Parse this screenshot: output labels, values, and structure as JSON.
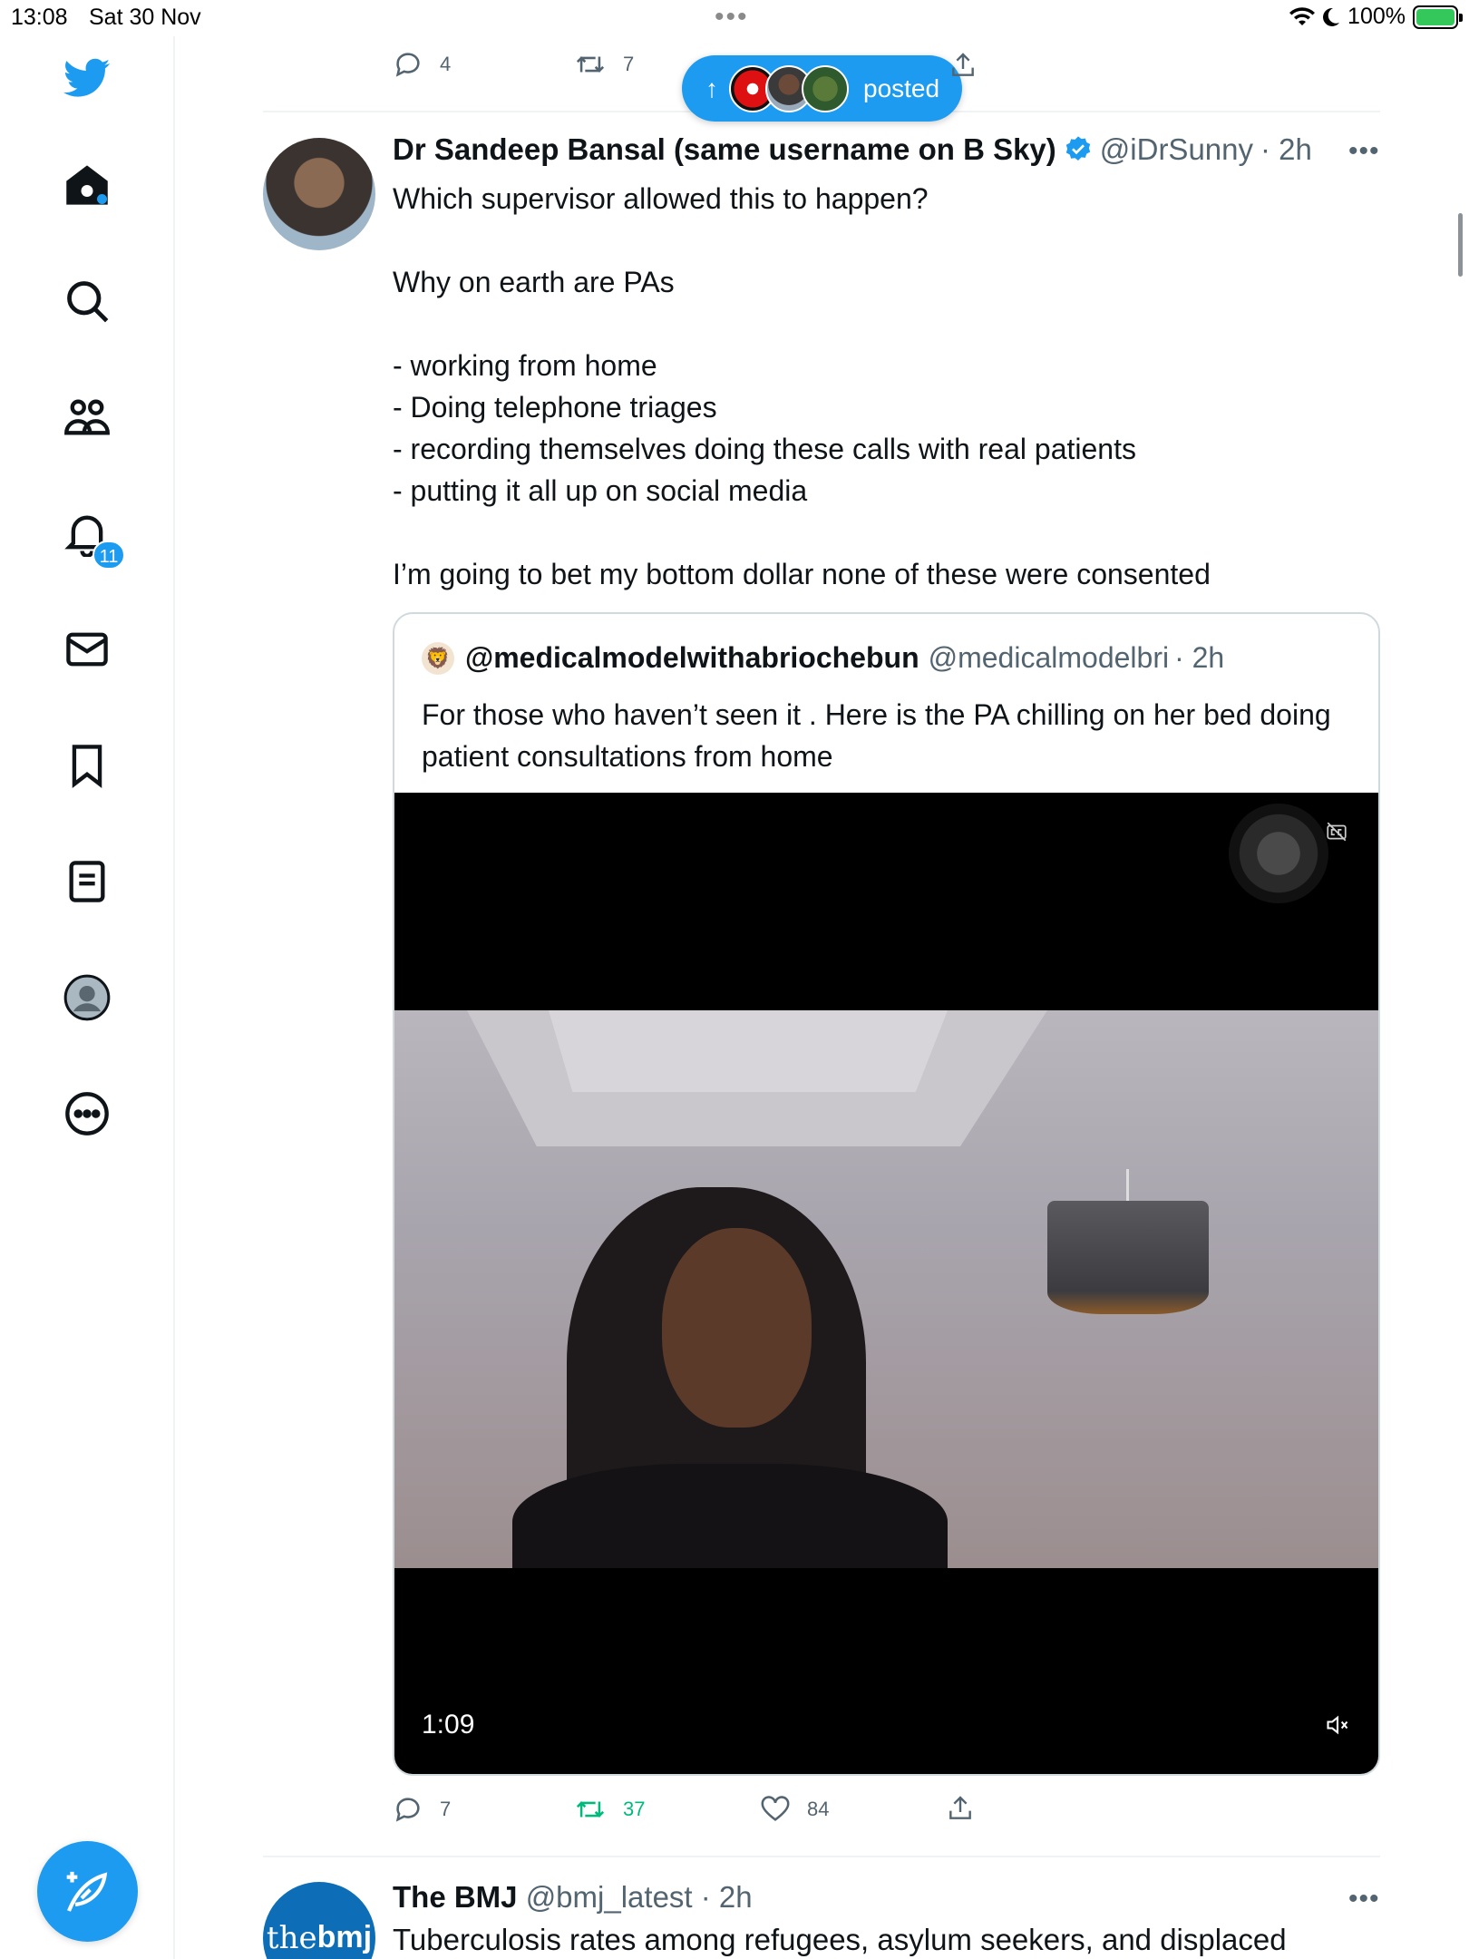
{
  "status_bar": {
    "time": "13:08",
    "date": "Sat 30 Nov",
    "battery": "100%",
    "icons": [
      "wifi-icon",
      "moon-icon",
      "battery-charging-icon"
    ]
  },
  "nav": {
    "items": [
      "twitter-logo-icon",
      "home-icon",
      "search-icon",
      "communities-icon",
      "notifications-icon",
      "messages-icon",
      "bookmarks-icon",
      "lists-icon",
      "profile-icon",
      "more-icon"
    ],
    "notifications_badge": "11",
    "compose_icon": "compose-icon"
  },
  "top_actions": {
    "replies": "4",
    "retweets": "7"
  },
  "posted_pill": {
    "label": "posted"
  },
  "tweet": {
    "author_name": "Dr Sandeep Bansal (same username on B Sky)",
    "handle": "@iDrSunny",
    "time": "· 2h",
    "text_lines": [
      "Which supervisor allowed this to happen?",
      "Why on earth are PAs",
      "- working from home\n- Doing telephone triages\n- recording themselves doing these calls with real patients\n- putting it all up on social media",
      "I’m going to bet my bottom dollar none of these were consented"
    ],
    "quote": {
      "name": "@medicalmodelwithabriochebun",
      "handle": "@medicalmodelbri",
      "time": "· 2h",
      "text": "For those who haven’t seen it . Here is the PA chilling  on her bed doing patient consultations from home",
      "video_time": "1:09"
    },
    "actions": {
      "replies": "7",
      "retweets": "37",
      "likes": "84"
    }
  },
  "next_tweet": {
    "avatar_text_a": "the",
    "avatar_text_b": "bmj",
    "author_name": "The BMJ",
    "handle": "@bmj_latest",
    "time": "· 2h",
    "text": "Tuberculosis rates among refugees, asylum seekers, and displaced"
  },
  "colors": {
    "accent": "#1d9bf0",
    "retweet_green": "#00ba7c",
    "secondary_text": "#536471",
    "border": "#cfd9de"
  }
}
